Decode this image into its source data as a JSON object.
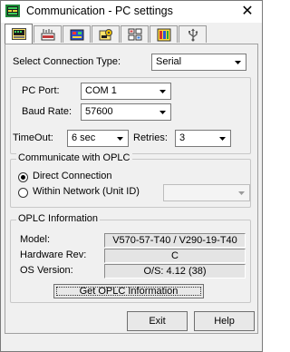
{
  "window": {
    "title": "Communication - PC settings",
    "close_glyph": "✕"
  },
  "tabs": [
    {
      "icon": "keyboard-icon",
      "active": true
    },
    {
      "icon": "network-device-icon",
      "active": false
    },
    {
      "icon": "modem-icon",
      "active": false
    },
    {
      "icon": "settings-gear-icon",
      "active": false
    },
    {
      "icon": "grid-icon",
      "active": false
    },
    {
      "icon": "plc-color-icon",
      "active": false
    },
    {
      "icon": "usb-icon",
      "active": false
    }
  ],
  "connection": {
    "label": "Select Connection Type:",
    "value": "Serial"
  },
  "serial": {
    "pc_port_label": "PC Port:",
    "pc_port_value": "COM 1",
    "baud_rate_label": "Baud Rate:",
    "baud_rate_value": "57600",
    "timeout_label": "TimeOut:",
    "timeout_value": "6 sec",
    "retries_label": "Retries:",
    "retries_value": "3"
  },
  "communicate": {
    "group_title": "Communicate with OPLC",
    "direct_label": "Direct Connection",
    "network_label": "Within Network (Unit ID)",
    "unit_id_value": ""
  },
  "info": {
    "group_title": "OPLC Information",
    "model_label": "Model:",
    "model_value": "V570-57-T40 / V290-19-T40",
    "hardware_label": "Hardware Rev:",
    "hardware_value": "C",
    "os_label": "OS Version:",
    "os_value": "O/S: 4.12 (38)",
    "get_info_button": "Get OPLC Information"
  },
  "footer": {
    "exit_button": "Exit",
    "help_button": "Help"
  },
  "colors": {
    "dialog_bg": "#f0f0f0",
    "titlebar_bg": "#ffffff",
    "field_bg": "#e4e4e4"
  }
}
